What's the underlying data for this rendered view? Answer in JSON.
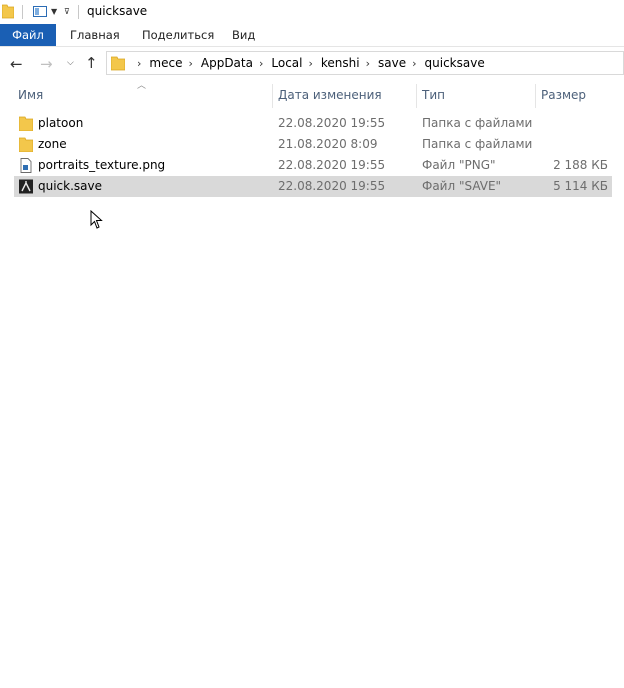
{
  "window": {
    "title": "quicksave"
  },
  "ribbon": {
    "tabs": [
      "Файл",
      "Главная",
      "Поделиться",
      "Вид"
    ]
  },
  "address": {
    "crumbs": [
      "mece",
      "AppData",
      "Local",
      "kenshi",
      "save",
      "quicksave"
    ]
  },
  "columns": {
    "name": "Имя",
    "date": "Дата изменения",
    "type": "Тип",
    "size": "Размер"
  },
  "files": [
    {
      "name": "platoon",
      "date": "22.08.2020 19:55",
      "type": "Папка с файлами",
      "size": "",
      "icon": "folder-icon"
    },
    {
      "name": "zone",
      "date": "21.08.2020 8:09",
      "type": "Папка с файлами",
      "size": "",
      "icon": "folder-icon"
    },
    {
      "name": "portraits_texture.png",
      "date": "22.08.2020 19:55",
      "type": "Файл \"PNG\"",
      "size": "2 188 КБ",
      "icon": "png-file-icon"
    },
    {
      "name": "quick.save",
      "date": "22.08.2020 19:55",
      "type": "Файл \"SAVE\"",
      "size": "5 114 КБ",
      "icon": "kenshi-save-icon",
      "selected": true
    }
  ],
  "colors": {
    "accent": "#1a5fb4",
    "selection": "#d9d9d9",
    "folder": "#f3c74b"
  }
}
